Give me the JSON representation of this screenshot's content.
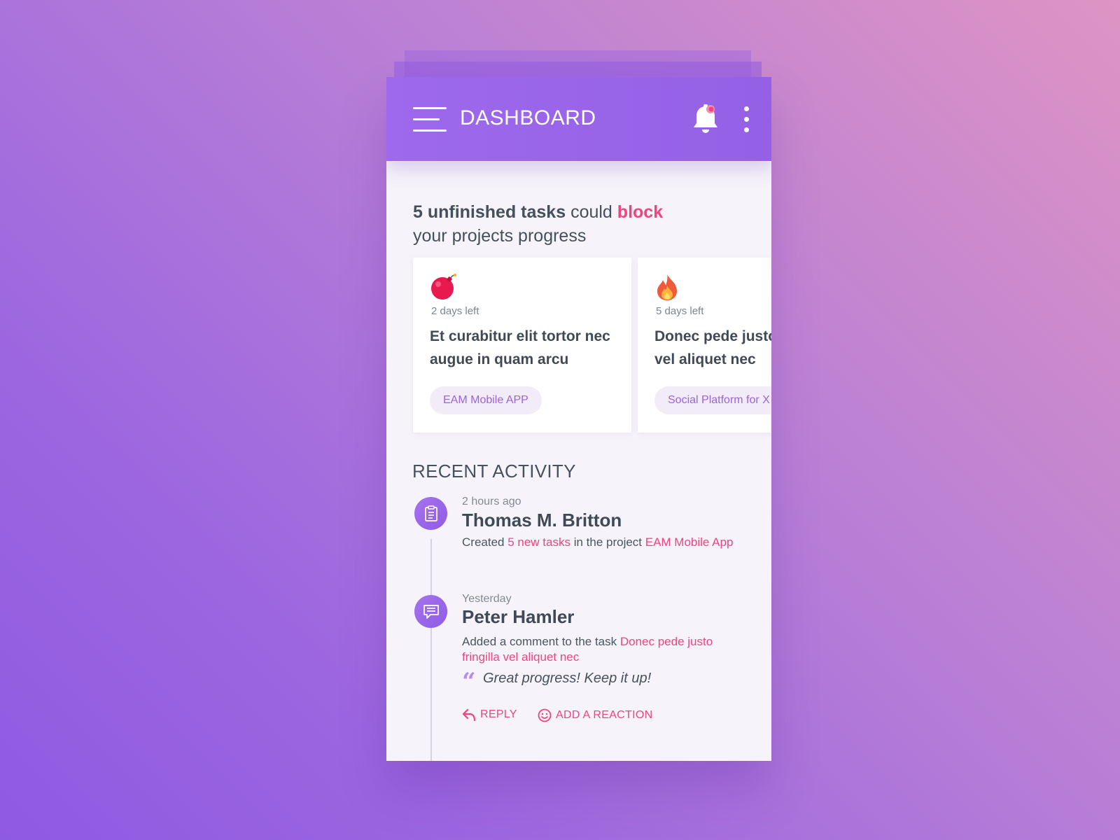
{
  "appbar": {
    "title": "DASHBOARD"
  },
  "headline": {
    "bold": "5 unfinished tasks",
    "mid": " could ",
    "danger": "block",
    "line2": "your projects progress"
  },
  "cards": [
    {
      "icon": "bomb-icon",
      "days_left": "2 days left",
      "task_line1": "Et curabitur elit tortor nec",
      "task_line2": "augue in quam arcu",
      "project": "EAM Mobile APP"
    },
    {
      "icon": "fire-icon",
      "days_left": "5 days left",
      "task_line1": "Donec pede justo,",
      "task_line2": "vel aliquet nec",
      "project": "Social Platform for X"
    }
  ],
  "recent_activity": {
    "title": "RECENT ACTIVITY",
    "items": [
      {
        "icon": "clipboard-icon",
        "time": "2 hours ago",
        "name": "Thomas M. Britton",
        "text_prefix": "Created ",
        "link1": "5 new tasks",
        "text_mid": " in the project ",
        "link2": "EAM Mobile App"
      },
      {
        "icon": "comment-icon",
        "time": "Yesterday",
        "name": "Peter Hamler",
        "text_prefix": "Added a comment to the task ",
        "link1_line1": "Donec pede justo",
        "link1_line2": "fringilla vel aliquet nec",
        "quote": "Great progress! Keep it up!",
        "reply_label": "REPLY",
        "reaction_label": "ADD A REACTION"
      }
    ]
  },
  "colors": {
    "accent": "#9b63e5",
    "danger": "#f0447e",
    "text": "#3f4a56",
    "notification_dot": "#f0447e"
  }
}
